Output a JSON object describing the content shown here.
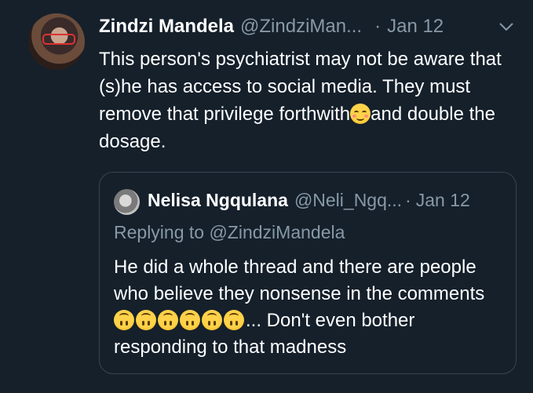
{
  "tweet": {
    "author_name": "Zindzi Mandela",
    "author_handle": "@ZindziMan...",
    "separator": "·",
    "date": "Jan 12",
    "text_part1": "This person's psychiatrist may not be aware that (s)he has access to social media. They must remove that privilege forthwith",
    "text_part2": "and double the dosage."
  },
  "quoted_tweet": {
    "author_name": "Nelisa Ngqulana",
    "author_handle": "@Neli_Ngq...",
    "separator": "·",
    "date": "Jan 12",
    "replying_to": "Replying to @ZindziMandela",
    "text_part1": "He did a whole thread and there are people who believe they nonsense in the comments ",
    "text_part2": "... Don't even bother responding to that madness"
  },
  "icons": {
    "menu": "chevron-down-icon",
    "emoji_main": "smiling-face-with-smiling-eyes",
    "emoji_quote": "upside-down-face",
    "emoji_quote_count": 6
  },
  "colors": {
    "background": "#15202b",
    "secondary_text": "#8899a6",
    "border": "#38444d"
  }
}
